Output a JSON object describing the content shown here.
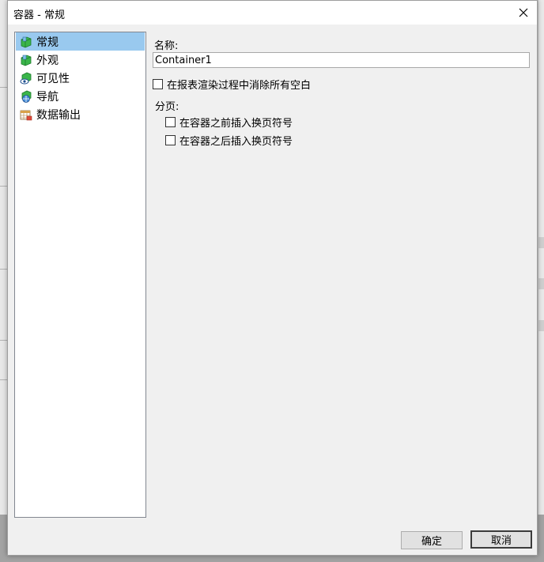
{
  "dialog": {
    "title": "容器 - 常规",
    "close_icon": "close-icon"
  },
  "tree": {
    "items": [
      {
        "label": "常规",
        "icon": "page-green-icon",
        "selected": true
      },
      {
        "label": "外观",
        "icon": "page-green-icon",
        "selected": false
      },
      {
        "label": "可见性",
        "icon": "eye-page-icon",
        "selected": false
      },
      {
        "label": "导航",
        "icon": "navigation-page-icon",
        "selected": false
      },
      {
        "label": "数据输出",
        "icon": "data-output-icon",
        "selected": false
      }
    ]
  },
  "general": {
    "name_label": "名称:",
    "name_value": "Container1",
    "remove_whitespace_label": "在报表渲染过程中消除所有空白",
    "remove_whitespace_checked": false,
    "pagination_label": "分页:",
    "page_break_before_label": "在容器之前插入换页符号",
    "page_break_before_checked": false,
    "page_break_after_label": "在容器之后插入换页符号",
    "page_break_after_checked": false
  },
  "buttons": {
    "ok": "确定",
    "cancel": "取消"
  },
  "colors": {
    "selection": "#99c9ef",
    "dialog_bg": "#f0f0f0",
    "tree_border": "#828790"
  }
}
